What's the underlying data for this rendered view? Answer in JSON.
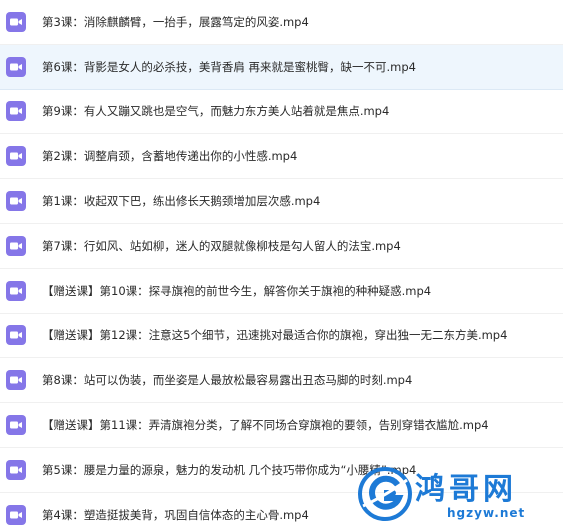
{
  "files": [
    {
      "name": "第3课：消除麒麟臂，一抬手，展露笃定的风姿.mp4",
      "icon": "video-file-icon"
    },
    {
      "name": "第6课：背影是女人的必杀技，美背香肩 再来就是蜜桃臀，缺一不可.mp4",
      "icon": "video-file-icon",
      "selected": true
    },
    {
      "name": "第9课：有人又蹦又跳也是空气，而魅力东方美人站着就是焦点.mp4",
      "icon": "video-file-icon"
    },
    {
      "name": "第2课：调整肩颈，含蓄地传递出你的小性感.mp4",
      "icon": "video-file-icon"
    },
    {
      "name": "第1课：收起双下巴，练出修长天鹅颈增加层次感.mp4",
      "icon": "video-file-icon"
    },
    {
      "name": "第7课：行如风、站如柳，迷人的双腿就像柳枝是勾人留人的法宝.mp4",
      "icon": "video-file-icon"
    },
    {
      "name": "【赠送课】第10课：探寻旗袍的前世今生，解答你关于旗袍的种种疑惑.mp4",
      "icon": "video-file-icon"
    },
    {
      "name": "【赠送课】第12课：注意这5个细节，迅速挑对最适合你的旗袍，穿出独一无二东方美.mp4",
      "icon": "video-file-icon"
    },
    {
      "name": "第8课：站可以伪装，而坐姿是人最放松最容易露出丑态马脚的时刻.mp4",
      "icon": "video-file-icon"
    },
    {
      "name": "【赠送课】第11课：弄清旗袍分类，了解不同场合穿旗袍的要领，告别穿错衣尴尬.mp4",
      "icon": "video-file-icon"
    },
    {
      "name": "第5课：腰是力量的源泉，魅力的发动机 几个技巧带你成为“小腰精”.mp4",
      "icon": "video-file-icon"
    },
    {
      "name": "第4课：塑造挺拔美背，巩固自信体态的主心骨.mp4",
      "icon": "video-file-icon"
    }
  ],
  "watermark": {
    "brand": "鸿哥网",
    "url": "hgzyw.net"
  },
  "colors": {
    "icon_purple": "#8576e8",
    "selected_bg": "#eef6fd",
    "watermark_blue": "#1d7ad6"
  }
}
